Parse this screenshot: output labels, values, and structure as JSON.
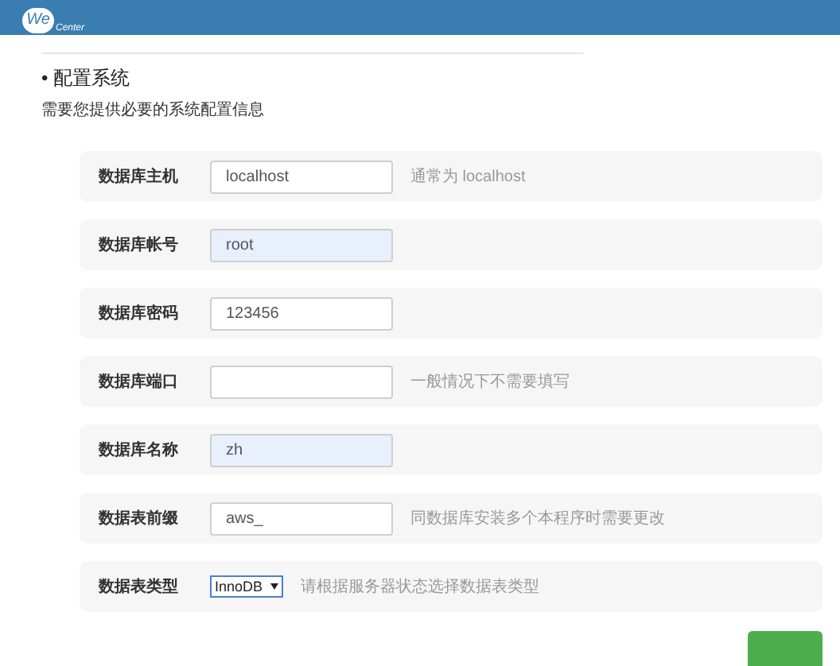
{
  "header": {
    "logo": {
      "main": "We",
      "sub": "Center"
    }
  },
  "section": {
    "bullet": "•",
    "title": "配置系统",
    "subtitle": "需要您提供必要的系统配置信息"
  },
  "fields": [
    {
      "kind": "input",
      "label": "数据库主机",
      "value": "localhost",
      "autofilled": false,
      "hint": "通常为 localhost"
    },
    {
      "kind": "input",
      "label": "数据库帐号",
      "value": "root",
      "autofilled": true
    },
    {
      "kind": "input",
      "label": "数据库密码",
      "value": "123456",
      "autofilled": false
    },
    {
      "kind": "input",
      "label": "数据库端口",
      "autofilled": false,
      "hint": "一般情况下不需要填写"
    },
    {
      "kind": "input",
      "label": "数据库名称",
      "value": "zh",
      "autofilled": true
    },
    {
      "kind": "input",
      "label": "数据表前缀",
      "value": "aws_",
      "autofilled": false,
      "hint": "同数据库安装多个本程序时需要更改"
    },
    {
      "kind": "select",
      "label": "数据表类型",
      "value": "InnoDB",
      "hint": "请根据服务器状态选择数据表类型"
    }
  ]
}
